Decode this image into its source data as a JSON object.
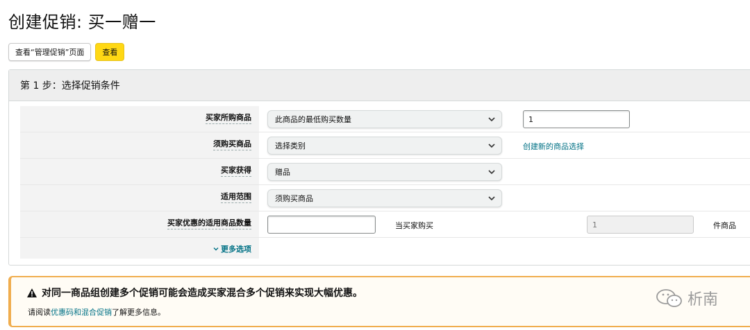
{
  "page": {
    "title": "创建促销: 买一赠一"
  },
  "toolbar": {
    "view_manage_label": "查看“管理促销”页面",
    "view_label": "查看"
  },
  "step": {
    "title": "第 1 步：选择促销条件"
  },
  "rows": {
    "buyer_purchase": {
      "label": "买家所购商品",
      "select_value": "此商品的最低购买数量",
      "input_value": "1"
    },
    "required_item": {
      "label": "须购买商品",
      "select_value": "选择类别",
      "link_text": "创建新的商品选择"
    },
    "buyer_gets": {
      "label": "买家获得",
      "select_value": "赠品"
    },
    "scope": {
      "label": "适用范围",
      "select_value": "须购买商品"
    },
    "discount_qty": {
      "label": "买家优惠的适用商品数量",
      "input_value": "",
      "when_text": "当买家购买",
      "disabled_value": "1",
      "unit_text": "件商品"
    },
    "more": {
      "label": "更多选项"
    }
  },
  "alert": {
    "title": "对同一商品组创建多个促销可能会造成买家混合多个促销来实现大幅优惠。",
    "body_prefix": "请阅读",
    "body_link": "优惠码和混合促销",
    "body_suffix": "了解更多信息。"
  },
  "watermark": {
    "text": "析南"
  },
  "colors": {
    "primary_button": "#ffd814",
    "link": "#007185",
    "alert_border": "#f0ad4e"
  },
  "icons": [
    "chevron-down-icon",
    "warning-icon",
    "wechat-icon"
  ]
}
